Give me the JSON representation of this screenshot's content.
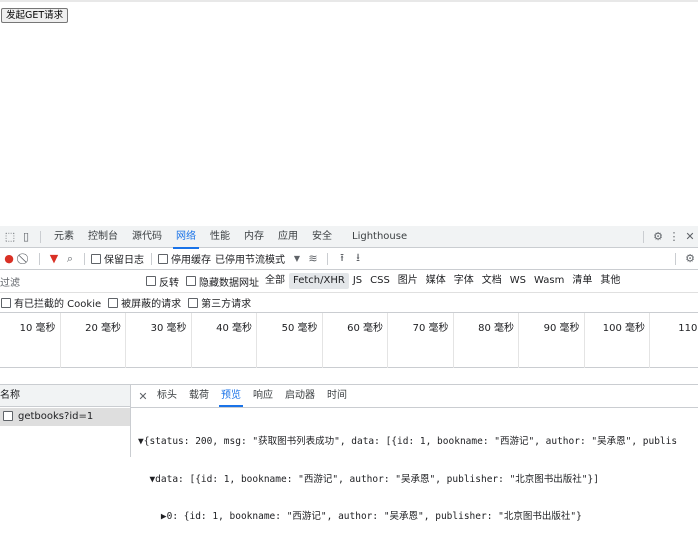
{
  "page": {
    "button_label": "发起GET请求"
  },
  "devtools": {
    "tabs": [
      "元素",
      "控制台",
      "源代码",
      "网络",
      "性能",
      "内存",
      "应用",
      "安全",
      "Lighthouse"
    ],
    "active_tab": "网络",
    "toolbar": {
      "preserve_log": "保留日志",
      "disable_cache": "停用缓存",
      "throttle": "已停用节流模式"
    },
    "filter": {
      "placeholder": "过滤",
      "invert": "反转",
      "hide_data_urls": "隐藏数据网址",
      "types": [
        "全部",
        "Fetch/XHR",
        "JS",
        "CSS",
        "图片",
        "媒体",
        "字体",
        "文档",
        "WS",
        "Wasm",
        "清单",
        "其他"
      ],
      "selected_type": "Fetch/XHR",
      "blocked_cookies": "有已拦截的 Cookie",
      "blocked_requests": "被屏蔽的请求",
      "third_party": "第三方请求"
    },
    "timeline_ticks": [
      "10 毫秒",
      "20 毫秒",
      "30 毫秒",
      "40 毫秒",
      "50 毫秒",
      "60 毫秒",
      "70 毫秒",
      "80 毫秒",
      "90 毫秒",
      "100 毫秒",
      "110 毫"
    ],
    "request_list": {
      "header": "名称",
      "items": [
        "getbooks?id=1"
      ]
    },
    "detail_tabs": [
      "标头",
      "载荷",
      "预览",
      "响应",
      "启动器",
      "时间"
    ],
    "active_detail_tab": "预览",
    "preview_lines": [
      "▼{status: 200, msg: \"获取图书列表成功\", data: [{id: 1, bookname: \"西游记\", author: \"吴承恩\", publis",
      "  ▼data: [{id: 1, bookname: \"西游记\", author: \"吴承恩\", publisher: \"北京图书出版社\"}]",
      "    ▶0: {id: 1, bookname: \"西游记\", author: \"吴承恩\", publisher: \"北京图书出版社\"}"
    ]
  }
}
